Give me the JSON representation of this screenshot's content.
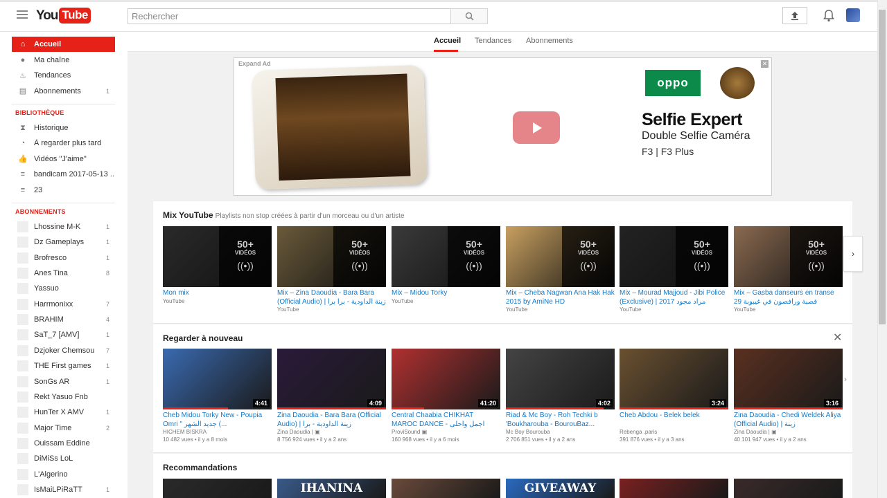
{
  "header": {
    "logo_you": "You",
    "logo_tube": "Tube",
    "search_placeholder": "Rechercher"
  },
  "tabs": [
    {
      "label": "Accueil"
    },
    {
      "label": "Tendances"
    },
    {
      "label": "Abonnements"
    }
  ],
  "sidebar": {
    "main": [
      {
        "label": "Accueil",
        "icon": "home-icon",
        "count": ""
      },
      {
        "label": "Ma chaîne",
        "icon": "user-icon",
        "count": ""
      },
      {
        "label": "Tendances",
        "icon": "flame-icon",
        "count": ""
      },
      {
        "label": "Abonnements",
        "icon": "subscriptions-icon",
        "count": "1"
      }
    ],
    "library_title": "BIBLIOTHÈQUE",
    "library": [
      {
        "label": "Historique",
        "icon": "hourglass-icon"
      },
      {
        "label": "À regarder plus tard",
        "icon": "clock-icon"
      },
      {
        "label": "Vidéos \"J'aime\"",
        "icon": "thumbs-up-icon"
      },
      {
        "label": "bandicam 2017-05-13 ...",
        "icon": "playlist-icon"
      },
      {
        "label": "23",
        "icon": "playlist-icon"
      }
    ],
    "subs_title": "ABONNEMENTS",
    "subs": [
      {
        "label": "Lhossine M-K",
        "count": "1"
      },
      {
        "label": "Dz Gameplays",
        "count": "1"
      },
      {
        "label": "Brofresco",
        "count": "1"
      },
      {
        "label": "Anes Tina",
        "count": "8"
      },
      {
        "label": "Yassuo",
        "count": ""
      },
      {
        "label": "Harrmonixx",
        "count": "7"
      },
      {
        "label": "BRAHIM",
        "count": "4"
      },
      {
        "label": "SaT_7 [AMV]",
        "count": "1"
      },
      {
        "label": "Dzjoker Chemsou",
        "count": "7"
      },
      {
        "label": "THE First games",
        "count": "1"
      },
      {
        "label": "SonGs AR",
        "count": "1"
      },
      {
        "label": "Rekt Yasuo Fnb",
        "count": ""
      },
      {
        "label": "HunTer X AMV",
        "count": "1"
      },
      {
        "label": "Major Time",
        "count": "2"
      },
      {
        "label": "Ouissam Eddine",
        "count": ""
      },
      {
        "label": "DiMiSs LoL",
        "count": ""
      },
      {
        "label": "L'Algerino",
        "count": ""
      },
      {
        "label": "IsMaiLPiRaTT",
        "count": "1"
      }
    ]
  },
  "ad": {
    "label": "Expand Ad",
    "brand": "oppo",
    "headline": "Selfie Expert",
    "subline": "Double Selfie Caméra",
    "models": "F3 | F3 Plus"
  },
  "mix_shelf": {
    "title": "Mix YouTube",
    "subtitle": "Playlists non stop créées à partir d'un morceau ou d'un artiste",
    "count_label": "50+",
    "videos_label": "VIDÉOS",
    "items": [
      {
        "title": "Mon mix",
        "channel": "YouTube",
        "color": "#2a2a2a"
      },
      {
        "title": "Mix – Zina Daoudia - Bara Bara (Official Audio) | زينة الداودية - برا برا",
        "channel": "YouTube",
        "color": "#6a5a3a"
      },
      {
        "title": "Mix – Midou Torky",
        "channel": "YouTube",
        "color": "#3a3a3a"
      },
      {
        "title": "Mix – Cheba Nagwan Ana Hak Hak 2015 by AmiNe HD",
        "channel": "YouTube",
        "color": "#c8a060"
      },
      {
        "title": "Mix – Mourad Majjoud - Jibi Police (Exclusive) | 2017 مراد مجود",
        "channel": "YouTube",
        "color": "#222222"
      },
      {
        "title": "Mix – Gasba danseurs en transe قصبة ورافصون في غيبوبة 29",
        "channel": "YouTube",
        "color": "#8a6a50"
      }
    ]
  },
  "rewatch_shelf": {
    "title": "Regarder à nouveau",
    "items": [
      {
        "title": "Cheb Midou Torky New - Poupia Omri \" جديد الشهر (...",
        "channel": "HICHEM BISKRA",
        "views": "10 482 vues",
        "age": "il y a 8 mois",
        "duration": "4:41",
        "progress": 0.6,
        "color": "#3a6ab0"
      },
      {
        "title": "Zina Daoudia - Bara Bara (Official Audio) | زينة الداودية - برا",
        "channel": "Zina Daoudia | ▣",
        "views": "8 756 924 vues",
        "age": "il y a 2 ans",
        "duration": "4:09",
        "progress": 1.0,
        "color": "#2a1a3a"
      },
      {
        "title": "Central Chaabia CHIKHAT MAROC DANCE - اجمل واحلى",
        "channel": "ProviSound ▣",
        "views": "160 968 vues",
        "age": "il y a 6 mois",
        "duration": "41:20",
        "progress": 0.3,
        "color": "#b03030"
      },
      {
        "title": "Riad & Mc Boy - Roh Techki b 'Boukharouba - BourouBaz...",
        "channel": "Mc Boy Bourouba",
        "views": "2 706 851 vues",
        "age": "il y a 2 ans",
        "duration": "4:02",
        "progress": 0.9,
        "color": "#444444"
      },
      {
        "title": "Cheb Abdou - Belek belek",
        "channel": "Rebenga .paris",
        "views": "391 876 vues",
        "age": "il y a 3 ans",
        "duration": "3:24",
        "progress": 1.0,
        "color": "#6a5030"
      },
      {
        "title": "Zina Daoudia - Chedi Weldek Aliya (Official Audio) | زينة",
        "channel": "Zina Daoudia | ▣",
        "views": "40 101 947 vues",
        "age": "il y a 2 ans",
        "duration": "3:16",
        "progress": 1.0,
        "color": "#5a3020"
      }
    ]
  },
  "reco_shelf": {
    "title": "Recommandations",
    "items": [
      {
        "color": "#2a2a2a"
      },
      {
        "color": "#3a5a8a",
        "overlay": "IHANINA"
      },
      {
        "color": "#6a4a3a"
      },
      {
        "color": "#2a6ac0",
        "overlay": "GIVEAWAY"
      },
      {
        "color": "#7a2020"
      },
      {
        "color": "#3a2a2a"
      }
    ]
  },
  "colors": {
    "accent": "#e62117",
    "link": "#167ac6"
  }
}
